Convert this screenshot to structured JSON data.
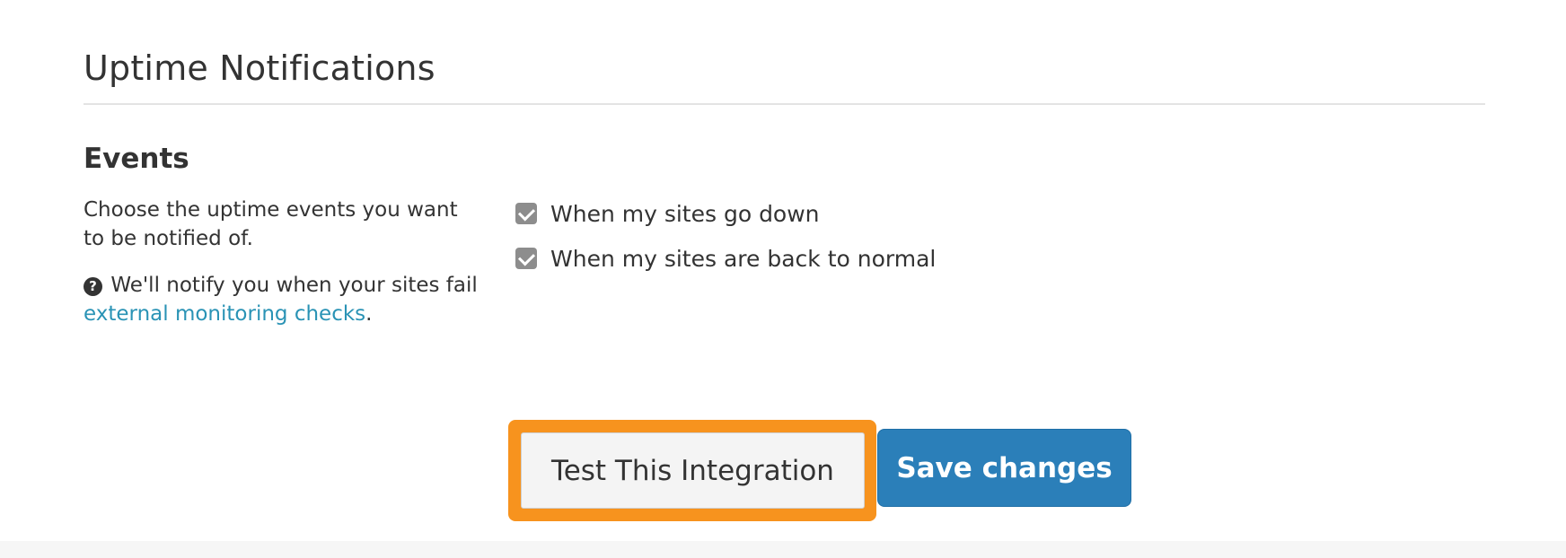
{
  "page": {
    "title": "Uptime Notifications"
  },
  "events": {
    "heading": "Events",
    "description": "Choose the uptime events you want to be notified of.",
    "help_text": "We'll notify you when your sites fail",
    "help_link": "external monitoring checks",
    "help_suffix": ".",
    "options": [
      {
        "label": "When my sites go down",
        "checked": true
      },
      {
        "label": "When my sites are back to normal",
        "checked": true
      }
    ]
  },
  "actions": {
    "test_label": "Test This Integration",
    "save_label": "Save changes",
    "highlight_color": "#f7931e",
    "save_color": "#2b7fb9",
    "link_color": "#2a93b5"
  }
}
